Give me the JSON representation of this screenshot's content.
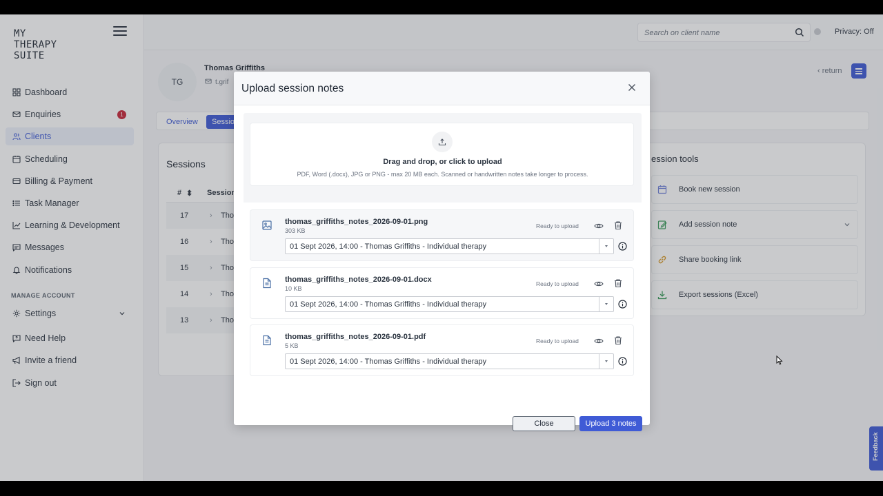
{
  "app": {
    "logo": "MY\nTHERAPY\nSUITE"
  },
  "sidebar": {
    "items": [
      {
        "label": "Dashboard",
        "icon": "grid-icon"
      },
      {
        "label": "Enquiries",
        "icon": "mail-icon",
        "badge": "1"
      },
      {
        "label": "Clients",
        "icon": "users-icon",
        "active": true
      },
      {
        "label": "Scheduling",
        "icon": "calendar-icon"
      },
      {
        "label": "Billing & Payment",
        "icon": "card-icon"
      },
      {
        "label": "Task Manager",
        "icon": "list-icon"
      },
      {
        "label": "Learning & Development",
        "icon": "chart-icon"
      },
      {
        "label": "Messages",
        "icon": "message-icon"
      },
      {
        "label": "Notifications",
        "icon": "bell-icon"
      }
    ],
    "manage_label": "MANAGE ACCOUNT",
    "account_items": [
      {
        "label": "Settings",
        "icon": "gear-icon"
      },
      {
        "label": "Need Help",
        "icon": "help-icon"
      },
      {
        "label": "Invite a friend",
        "icon": "megaphone-icon"
      },
      {
        "label": "Sign out",
        "icon": "signout-icon"
      }
    ]
  },
  "topbar": {
    "search_placeholder": "Search on client name",
    "privacy": "Privacy: Off"
  },
  "client": {
    "initials": "TG",
    "name": "Thomas Griffiths",
    "email": "t.grif"
  },
  "header": {
    "return_label": "return"
  },
  "tabs": [
    {
      "label": "Overview"
    },
    {
      "label": "Sessio"
    }
  ],
  "sessions": {
    "title": "Sessions",
    "col_num": "#",
    "col_session": "Session",
    "rows": [
      {
        "num": "17",
        "name": "Tho"
      },
      {
        "num": "16",
        "name": "Tho"
      },
      {
        "num": "15",
        "name": "Tho"
      },
      {
        "num": "14",
        "name": "Tho"
      },
      {
        "num": "13",
        "name": "Tho"
      }
    ]
  },
  "tools": {
    "title": "ession tools",
    "items": [
      {
        "label": "Book new session",
        "icon": "calendar-plus-icon"
      },
      {
        "label": "Add session note",
        "icon": "note-edit-icon"
      },
      {
        "label": "Share booking link",
        "icon": "link-icon"
      },
      {
        "label": "Export sessions (Excel)",
        "icon": "download-icon"
      }
    ]
  },
  "feedback_label": "Feedback",
  "modal": {
    "title": "Upload session notes",
    "dropzone": {
      "main": "Drag and drop, or click to upload",
      "sub": "PDF, Word (.docx), JPG or PNG - max 20 MB each. Scanned or handwritten notes take longer to process."
    },
    "files": [
      {
        "name": "thomas_griffiths_notes_2026-09-01.png",
        "size": "303 KB",
        "status": "Ready to upload",
        "session": "01 Sept 2026, 14:00 - Thomas Griffiths - Individual therapy",
        "icon": "image-file-icon"
      },
      {
        "name": "thomas_griffiths_notes_2026-09-01.docx",
        "size": "10 KB",
        "status": "Ready to upload",
        "session": "01 Sept 2026, 14:00 - Thomas Griffiths - Individual therapy",
        "icon": "document-file-icon"
      },
      {
        "name": "thomas_griffiths_notes_2026-09-01.pdf",
        "size": "5 KB",
        "status": "Ready to upload",
        "session": "01 Sept 2026, 14:00 - Thomas Griffiths - Individual therapy",
        "icon": "document-file-icon"
      }
    ],
    "close_label": "Close",
    "upload_label": "Upload 3 notes"
  },
  "colors": {
    "accent": "#3f5bd6",
    "badge": "#c8283a"
  }
}
